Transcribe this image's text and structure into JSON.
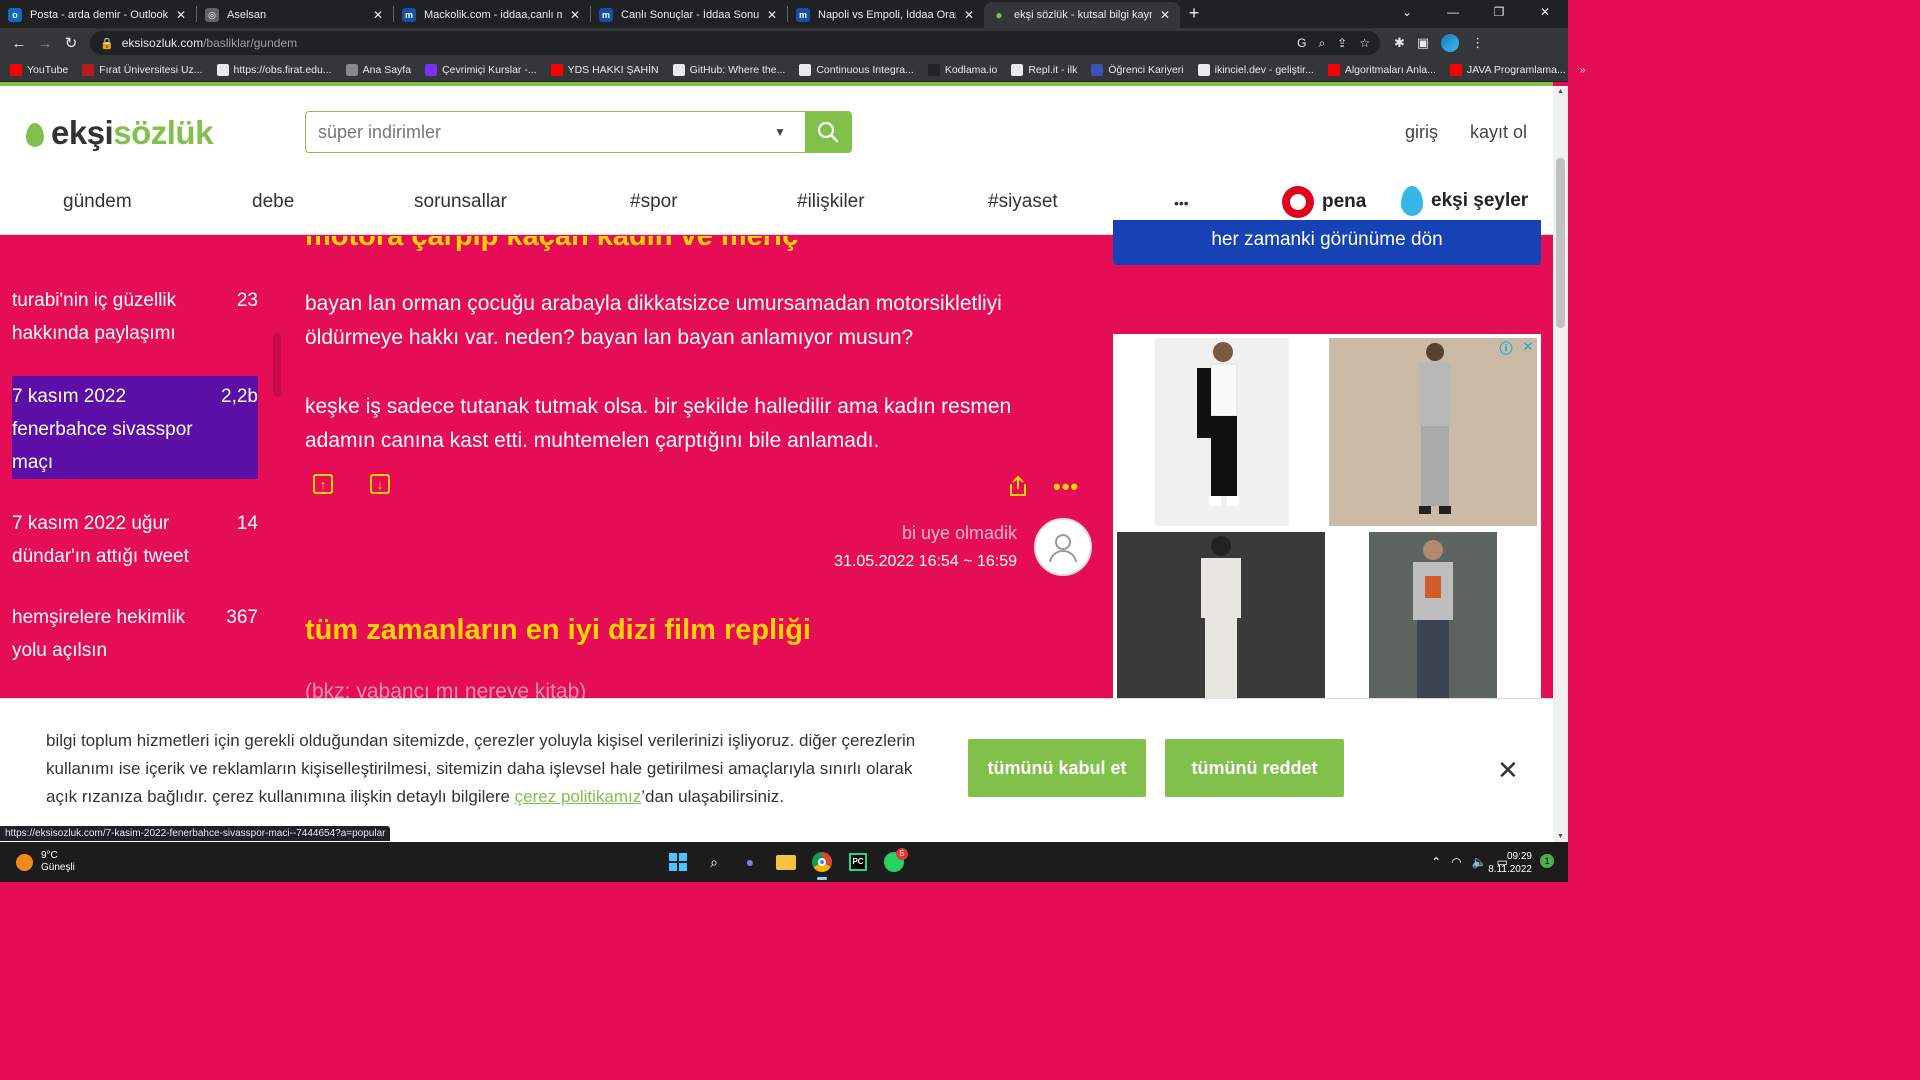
{
  "browser": {
    "tabs": [
      {
        "title": "Posta - arda demir - Outlook",
        "favicon_color": "#0f6cbd",
        "favicon": "o"
      },
      {
        "title": "Aselsan",
        "favicon_color": "#5f6368",
        "favicon": "◎"
      },
      {
        "title": "Mackolik.com - iddaa,canlı maç,i",
        "favicon_color": "#1a4ea3",
        "favicon": "m"
      },
      {
        "title": "Canlı Sonuçlar - İddaa Sonuçları",
        "favicon_color": "#1a4ea3",
        "favicon": "m"
      },
      {
        "title": "Napoli vs Empoli, İddaa Oranları",
        "favicon_color": "#1a4ea3",
        "favicon": "m"
      },
      {
        "title": "ekşi sözlük - kutsal bilgi kaynağı",
        "favicon_color": "#81c14b",
        "favicon": "●",
        "active": true
      }
    ],
    "url_host": "eksisozluk.com",
    "url_path": "/basliklar/gundem",
    "bookmarks": [
      {
        "label": "YouTube",
        "color": "#ff0000"
      },
      {
        "label": "Fırat Üniversitesi Uz...",
        "color": "#b71c1c"
      },
      {
        "label": "https://obs.firat.edu...",
        "color": "#e8eaed"
      },
      {
        "label": "Ana Sayfa",
        "color": "#888888"
      },
      {
        "label": "Çevrimiçi Kurslar -...",
        "color": "#7b2ff7"
      },
      {
        "label": "YDS HAKKI ŞAHİN",
        "color": "#ff0000"
      },
      {
        "label": "GitHub: Where the...",
        "color": "#e8eaed"
      },
      {
        "label": "Continuous Integra...",
        "color": "#e8eaed"
      },
      {
        "label": "Kodlama.io",
        "color": "#222222"
      },
      {
        "label": "Repl.it - ilk",
        "color": "#e8eaed"
      },
      {
        "label": "Öğrenci Kariyeri",
        "color": "#3f51b5"
      },
      {
        "label": "ikinciel.dev - geliştir...",
        "color": "#e8eaed"
      },
      {
        "label": "Algoritmaları Anla...",
        "color": "#ff0000"
      },
      {
        "label": "JAVA Programlama...",
        "color": "#ff0000"
      }
    ],
    "status_url": "https://eksisozluk.com/7-kasim-2022-fenerbahce-sivasspor-maci--7444654?a=popular"
  },
  "site": {
    "logo_part1": "ekşi",
    "logo_part2": "sözlük",
    "search_placeholder": "süper indirimler",
    "auth": {
      "login": "giriş",
      "register": "kayıt ol"
    },
    "nav": [
      "gündem",
      "debe",
      "sorunsallar",
      "#spor",
      "#ilişkiler",
      "#siyaset",
      "•••"
    ],
    "brands": {
      "pena": "pena",
      "seyler": "ekşi şeyler"
    },
    "accent": "#81c14b",
    "bg": "#e50d55"
  },
  "sidebar": {
    "items": [
      {
        "title": "turabi'nin iç güzellik hakkında paylaşımı",
        "count": "23"
      },
      {
        "title": "7 kasım 2022 fenerbahce sivasspor maçı",
        "count": "2,2b",
        "active": true
      },
      {
        "title": "7 kasım 2022 uğur dündar'ın attığı tweet",
        "count": "14"
      },
      {
        "title": "hemşirelere hekimlik yolu açılsın",
        "count": "367"
      }
    ]
  },
  "main": {
    "cut_title": "motora çarpıp kaçan kadın ve meriç",
    "paragraph1": "bayan lan orman çocuğu arabayla dikkatsizce umursamadan motorsikletliyi öldürmeye hakkı var. neden? bayan lan bayan anlamıyor musun?",
    "paragraph2": "keşke iş sadece tutanak tutmak olsa. bir şekilde halledilir ama kadın resmen adamın canına kast etti. muhtemelen çarptığını bile anlamadı.",
    "author": "bi uye olmadik",
    "date": "31.05.2022 16:54 ~ 16:59",
    "title2": "tüm zamanların en iyi dizi film repliği",
    "cut_body": "(bkz: yabancı mı nereye kitab)"
  },
  "right": {
    "classic_view": "her zamanki görünüme dön"
  },
  "cookie": {
    "text_before": "bilgi toplum hizmetleri için gerekli olduğundan sitemizde, çerezler yoluyla kişisel verilerinizi işliyoruz. diğer çerezlerin kullanımı ise içerik ve reklamların kişiselleştirilmesi, sitemizin daha işlevsel hale getirilmesi amaçlarıyla sınırlı olarak açık rızanıza bağlıdır. çerez kullanımına ilişkin detaylı bilgilere ",
    "link": "çerez politikamız",
    "text_after": "’dan ulaşabilirsiniz.",
    "accept": "tümünü kabul et",
    "reject": "tümünü reddet"
  },
  "taskbar": {
    "temp": "9°C",
    "weather": "Güneşli",
    "time": "09:29",
    "date": "8.11.2022",
    "whatsapp_badge": "5",
    "notif_count": "1"
  }
}
